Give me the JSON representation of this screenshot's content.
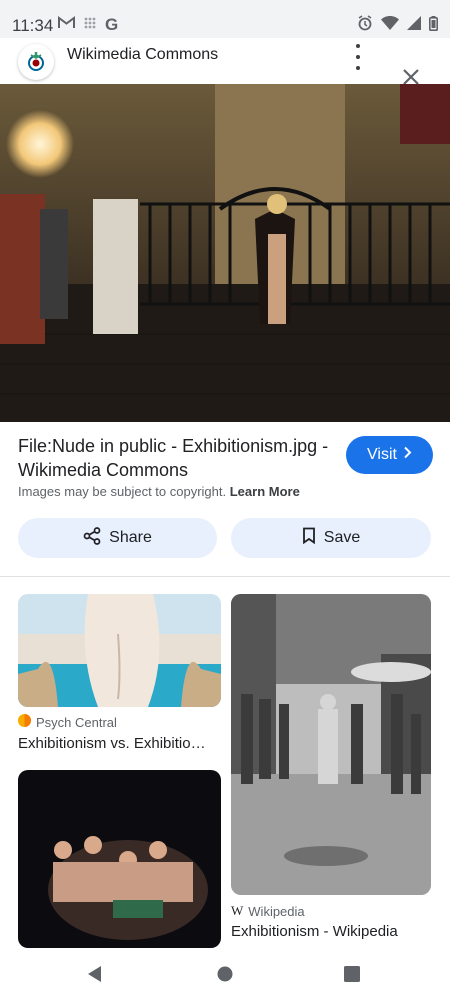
{
  "status": {
    "time": "11:34",
    "left_icons": [
      "gmail-icon",
      "grid-icon",
      "google-icon"
    ],
    "right_icons": [
      "alarm-icon",
      "wifi-icon",
      "signal-icon",
      "battery-icon"
    ]
  },
  "site": {
    "name": "Wikimedia Commons",
    "favicon": "wikimedia-logo"
  },
  "result": {
    "title": "File:Nude in public - Exhibitionism.jpg - Wikimedia Commons",
    "visit_label": "Visit",
    "copyright_text": "Images may be subject to copyright.",
    "learn_more": "Learn More"
  },
  "actions": {
    "share_label": "Share",
    "save_label": "Save"
  },
  "related": [
    {
      "source": "Psych Central",
      "caption": "Exhibitionism vs. Exhibitio…"
    },
    {
      "source": "Wikipedia",
      "caption": "Exhibitionism - Wikipedia"
    }
  ],
  "colors": {
    "accent": "#1a73e8",
    "pill": "#e8f0fe"
  }
}
